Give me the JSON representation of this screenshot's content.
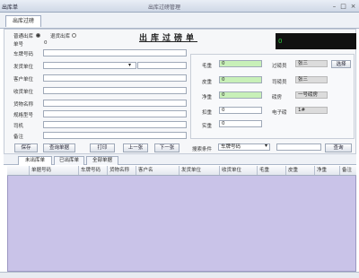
{
  "window": {
    "app_title": "出库单",
    "title": "出库过磅管理"
  },
  "tabs": {
    "main": "出库过磅"
  },
  "form": {
    "mode_options": [
      "普通出库",
      "退货出库"
    ],
    "document_title": "出库过磅单",
    "left_labels": [
      "单号",
      "车牌号码",
      "发货单位",
      "客户单位",
      "收货单位",
      "货物名称",
      "规格型号",
      "司机",
      "备注"
    ],
    "doc_number": "0",
    "display_value": "0"
  },
  "weights": {
    "labels": [
      "毛重",
      "皮重",
      "净重",
      "扣重",
      "实重"
    ],
    "values": [
      "0",
      "0",
      "0",
      "0",
      "0"
    ]
  },
  "info": {
    "labels": [
      "过磅员",
      "司磅员",
      "磅房",
      "电子磅"
    ],
    "values": [
      "张三",
      "张三",
      "一号磅房",
      "1#"
    ],
    "extra_button": "选择"
  },
  "toolbar": {
    "buttons": [
      "保存",
      "查询单据",
      "打印",
      "上一张",
      "下一张"
    ],
    "search_label": "搜索条件",
    "search_value": "车牌号码",
    "search_button": "查询"
  },
  "subtabs": [
    "未出库单",
    "已出库单",
    "全部单据"
  ],
  "grid": {
    "columns": [
      "单据号码",
      "车牌号码",
      "货物名称",
      "客户名",
      "发货单位",
      "收货单位",
      "毛重",
      "皮重",
      "净重",
      "备注"
    ]
  }
}
